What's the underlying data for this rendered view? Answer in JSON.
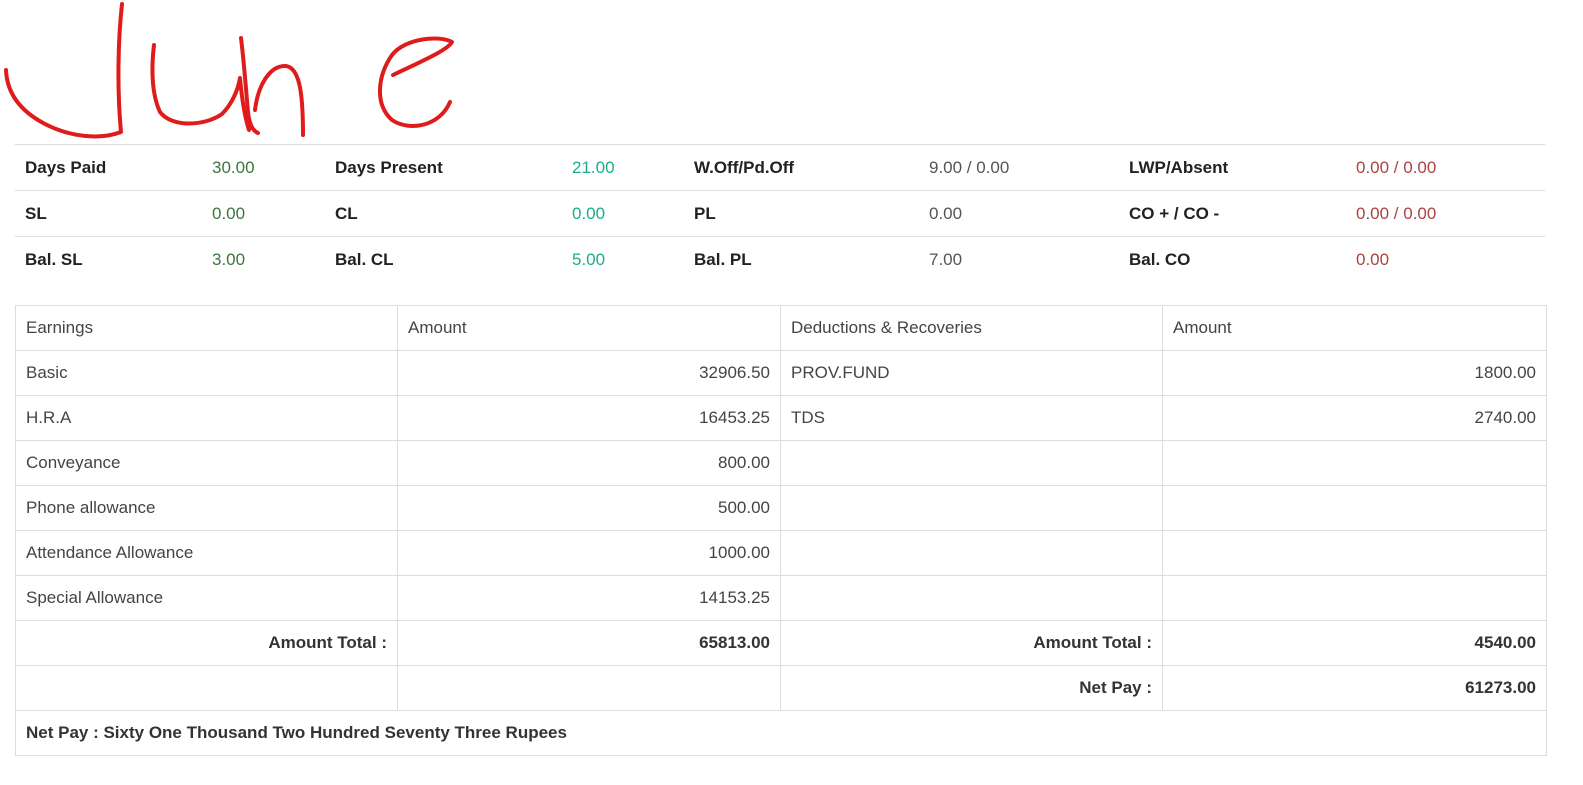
{
  "annotation": {
    "handwritten_text": "June",
    "color": "#e01b1b"
  },
  "summary": {
    "rows": [
      [
        {
          "label": "Days Paid",
          "value": "30.00",
          "color": "green"
        },
        {
          "label": "Days Present",
          "value": "21.00",
          "color": "teal"
        },
        {
          "label": "W.Off/Pd.Off",
          "value": "9.00 / 0.00",
          "color": "gray"
        },
        {
          "label": "LWP/Absent",
          "value": "0.00 / 0.00",
          "color": "red"
        }
      ],
      [
        {
          "label": "SL",
          "value": "0.00",
          "color": "green"
        },
        {
          "label": "CL",
          "value": "0.00",
          "color": "teal"
        },
        {
          "label": "PL",
          "value": "0.00",
          "color": "gray"
        },
        {
          "label": "CO + / CO -",
          "value": "0.00 / 0.00",
          "color": "red"
        }
      ],
      [
        {
          "label": "Bal. SL",
          "value": "3.00",
          "color": "green"
        },
        {
          "label": "Bal. CL",
          "value": "5.00",
          "color": "teal"
        },
        {
          "label": "Bal. PL",
          "value": "7.00",
          "color": "gray"
        },
        {
          "label": "Bal. CO",
          "value": "0.00",
          "color": "red"
        }
      ]
    ]
  },
  "salary": {
    "headers": {
      "earnings": "Earnings",
      "earnings_amount": "Amount",
      "deductions": "Deductions & Recoveries",
      "deductions_amount": "Amount"
    },
    "rows": [
      {
        "earning": "Basic",
        "earning_amount": "32906.50",
        "deduction": "PROV.FUND",
        "deduction_amount": "1800.00"
      },
      {
        "earning": "H.R.A",
        "earning_amount": "16453.25",
        "deduction": "TDS",
        "deduction_amount": "2740.00"
      },
      {
        "earning": "Conveyance",
        "earning_amount": "800.00",
        "deduction": "",
        "deduction_amount": ""
      },
      {
        "earning": "Phone allowance",
        "earning_amount": "500.00",
        "deduction": "",
        "deduction_amount": ""
      },
      {
        "earning": "Attendance Allowance",
        "earning_amount": "1000.00",
        "deduction": "",
        "deduction_amount": ""
      },
      {
        "earning": "Special Allowance",
        "earning_amount": "14153.25",
        "deduction": "",
        "deduction_amount": ""
      }
    ],
    "totals": {
      "earnings_label": "Amount Total :",
      "earnings_total": "65813.00",
      "deductions_label": "Amount Total :",
      "deductions_total": "4540.00"
    },
    "net_pay": {
      "label": "Net Pay :",
      "value": "61273.00",
      "in_words": "Net Pay : Sixty One Thousand Two Hundred Seventy Three Rupees"
    }
  }
}
